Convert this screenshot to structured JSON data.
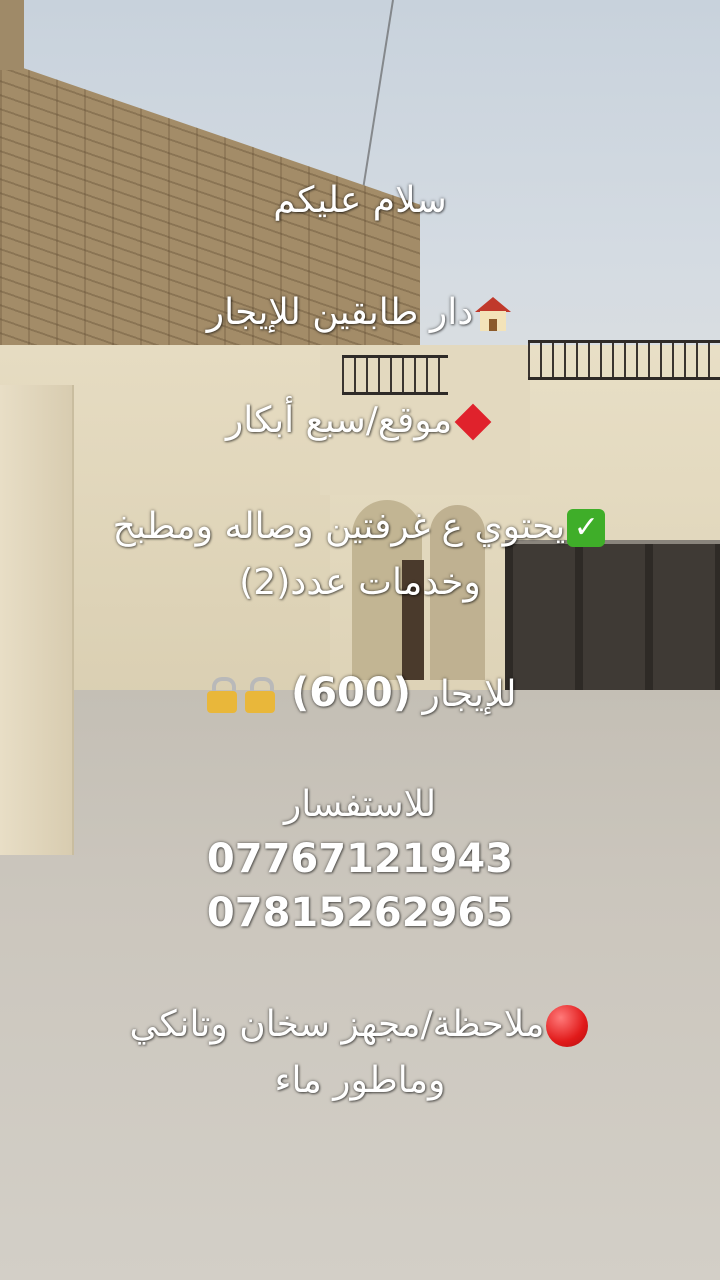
{
  "post": {
    "greeting": "سلام عليكم",
    "title": "دار طابقين للإيجار",
    "location": "موقع/سبع أبكار",
    "contents_line1": "يحتوي ع غرفتين وصاله ومطبخ",
    "contents_line2": "وخدمات عدد(2)",
    "rent_label": "للإيجار",
    "rent_value": "(600)",
    "inquiry_label": "للاستفسار",
    "phone_1": "07767121943",
    "phone_2": "07815262965",
    "note_line1": "ملاحظة/مجهز سخان وتانكي",
    "note_line2": "وماطور ماء"
  },
  "icons": {
    "title": "house-icon",
    "location": "red-diamond-icon",
    "contents": "check-mark-icon",
    "rent": "lock-icon",
    "note": "red-circle-icon"
  }
}
